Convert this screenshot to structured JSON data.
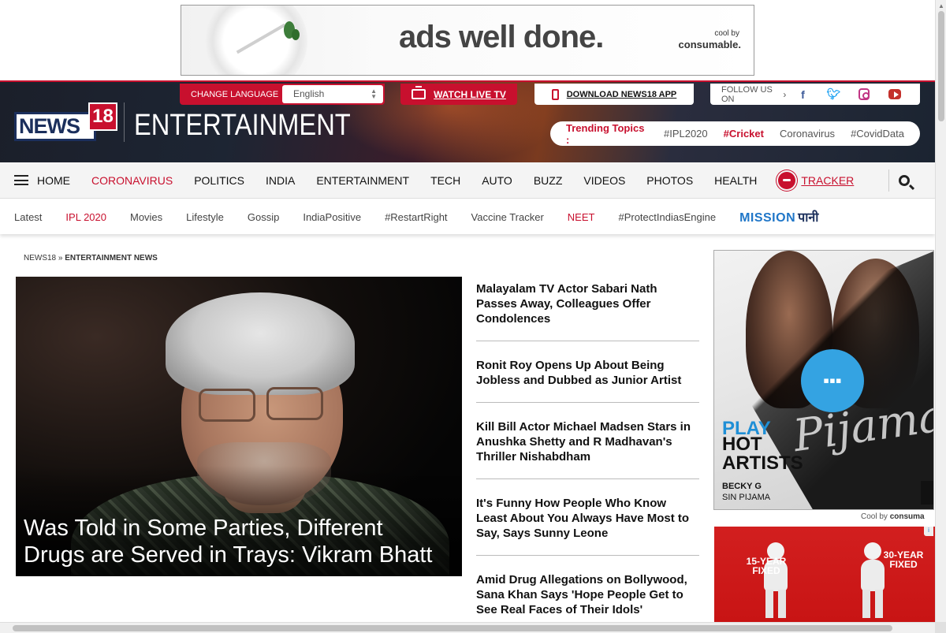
{
  "top_ad": {
    "headline": "ads well done.",
    "cool_by": "cool by",
    "brand": "consumable."
  },
  "header": {
    "change_language_label": "CHANGE LANGUAGE",
    "language_value": "English",
    "watch_live_label": "WATCH LIVE TV",
    "download_app_label": "DOWNLOAD NEWS18 APP",
    "follow_label": "FOLLOW US ON",
    "logo_text": "NEWS",
    "logo_number": "18",
    "section_title": "ENTERTAINMENT",
    "trending_label": "Trending Topics :",
    "trending_topics": [
      "#IPL2020",
      "#Cricket",
      "Coronavirus",
      "#CovidData"
    ]
  },
  "main_nav": {
    "items": [
      "HOME",
      "CORONAVIRUS",
      "POLITICS",
      "INDIA",
      "ENTERTAINMENT",
      "TECH",
      "AUTO",
      "BUZZ",
      "VIDEOS",
      "PHOTOS",
      "HEALTH"
    ],
    "tracker_label": "TRACKER"
  },
  "sub_nav": {
    "items": [
      "Latest",
      "IPL 2020",
      "Movies",
      "Lifestyle",
      "Gossip",
      "IndiaPositive",
      "#RestartRight",
      "Vaccine Tracker",
      "NEET",
      "#ProtectIndiasEngine"
    ],
    "mission_a": "MISSION",
    "mission_b": "पानी"
  },
  "breadcrumb": {
    "root": "NEWS18",
    "sep": " » ",
    "current": "ENTERTAINMENT NEWS"
  },
  "hero": {
    "title": "Was Told in Some Parties, Different Drugs are Served in Trays: Vikram Bhatt"
  },
  "headlines": [
    "Malayalam TV Actor Sabari Nath Passes Away, Colleagues Offer Condolences",
    "Ronit Roy Opens Up About Being Jobless and Dubbed as Junior Artist",
    "Kill Bill Actor Michael Madsen Stars in Anushka Shetty and R Madhavan's Thriller Nishabdham",
    "It's Funny How People Who Know Least About You Always Have Most to Say, Says Sunny Leone",
    "Amid Drug Allegations on Bollywood, Sana Khan Says 'Hope People Get to See Real Faces of Their Idols'"
  ],
  "side_ad_1": {
    "play": "PLAY",
    "hot": "HOT",
    "artists": "ARTISTS",
    "artist_name": "BECKY G",
    "song": "SIN PIJAMA",
    "cursive": "Pijama",
    "play_glyph": "▪▪▪",
    "cool_by": "Cool by",
    "brand": "consuma"
  },
  "side_ad_2": {
    "label_1": "15-YEAR FIXED",
    "label_2": "30-YEAR FIXED",
    "info": "i"
  }
}
